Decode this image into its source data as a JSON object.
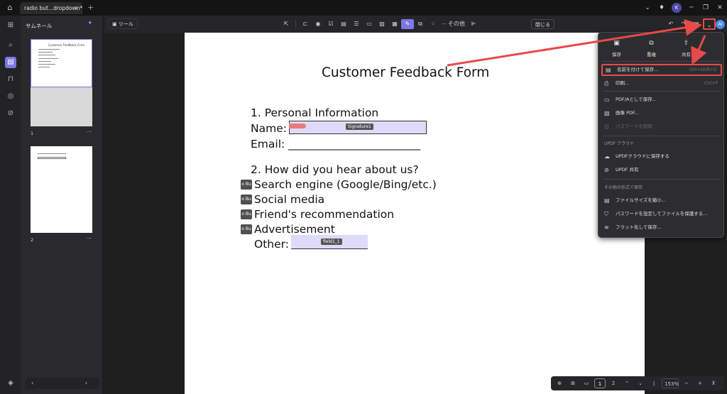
{
  "titlebar": {
    "tab_title": "radio but...dropdown*",
    "tab_close": "×",
    "new_tab": "+",
    "avatar": "K"
  },
  "rail": {
    "icons": [
      "thumbnails-icon",
      "search-icon",
      "page-icon",
      "bookmark-icon",
      "comment-icon",
      "attachment-icon",
      "layers-icon"
    ]
  },
  "thumbnails": {
    "title": "サムネール",
    "pages": [
      {
        "number": "1",
        "more": "···",
        "mini_title": "Customer Feedback Form"
      },
      {
        "number": "2",
        "more": "···"
      }
    ]
  },
  "toolbar": {
    "tool_label": "ツール",
    "more_label": "その他",
    "close_label": "閉じる"
  },
  "document": {
    "title": "Customer Feedback Form",
    "section1": "1. Personal Information",
    "name_label": "Name:",
    "signature_field": "Signature1",
    "email_line": "Email: ________________________",
    "section2": "2. How did you hear about us?",
    "radio_tag": "o Bu",
    "options": [
      "Search engine (Google/Bing/etc.)",
      "Social media",
      "Friend's recommendation",
      "Advertisement"
    ],
    "other_label": "Other:",
    "other_field": "field1_1"
  },
  "menu": {
    "top": [
      {
        "label": "保存",
        "icon": "save-icon"
      },
      {
        "label": "重複",
        "icon": "duplicate-icon"
      },
      {
        "label": "共有",
        "icon": "share-icon"
      }
    ],
    "save_as": {
      "label": "名前を付けて保存...",
      "shortcut": "Ctrl+Shift+S"
    },
    "print": {
      "label": "印刷...",
      "shortcut": "Ctrl+P"
    },
    "save_pdfa": "PDF/Aとして保存...",
    "image_pdf": "画像 PDF...",
    "remove_password": "パスワードを削除",
    "cloud_section": "UPDF クラウド",
    "save_cloud": "UPDFクラウドに保存する",
    "updf_share": "UPDF 共有",
    "other_section": "その他の形式で保存",
    "reduce_size": "ファイルサイズを縮小...",
    "protect_password": "パスワードを設定してファイルを保護する...",
    "flatten": "フラット化して保存..."
  },
  "bottombar": {
    "page_current": "1",
    "page_next": "2",
    "zoom": "153%",
    "zoom_out": "−",
    "zoom_in": "+"
  },
  "colors": {
    "accent": "#7d77e6",
    "highlight_red": "#e8494a",
    "field_fill": "#dcdcfa"
  }
}
